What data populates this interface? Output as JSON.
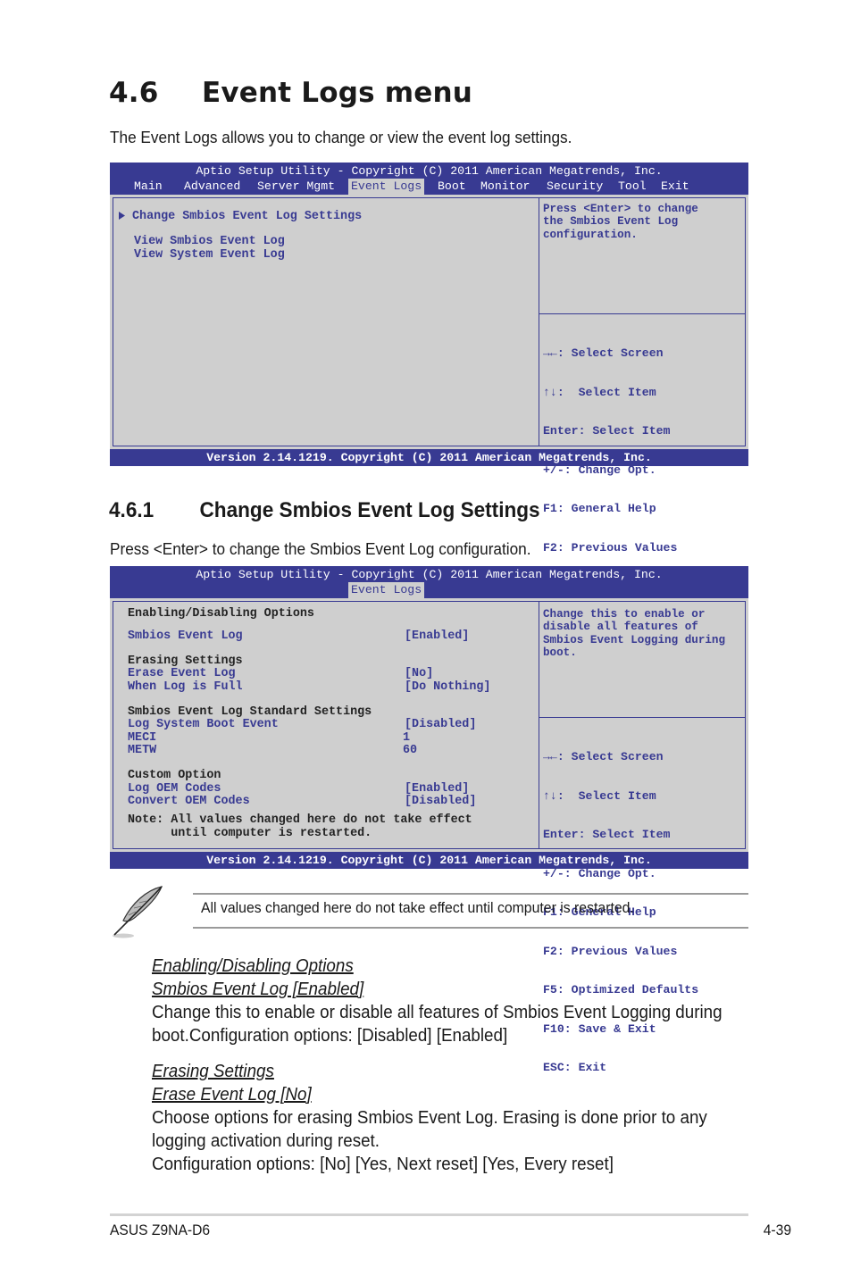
{
  "section": {
    "number": "4.6",
    "title": "Event Logs menu",
    "intro": "The Event Logs allows you to change or view the event log settings."
  },
  "bios1": {
    "title": "Aptio Setup Utility - Copyright (C) 2011 American Megatrends, Inc.",
    "tabs": [
      {
        "label": "Main",
        "active": false
      },
      {
        "label": "Advanced",
        "active": false
      },
      {
        "label": "Server Mgmt",
        "active": false
      },
      {
        "label": "Event Logs",
        "active": true
      },
      {
        "label": "Boot",
        "active": false
      },
      {
        "label": "Monitor",
        "active": false
      },
      {
        "label": "Security",
        "active": false
      },
      {
        "label": "Tool",
        "active": false
      },
      {
        "label": "Exit",
        "active": false
      }
    ],
    "items": [
      {
        "label": "Change Smbios Event Log Settings",
        "submenu": true
      },
      {
        "label": "View Smbios Event Log",
        "submenu": false
      },
      {
        "label": "View System Event Log",
        "submenu": false
      }
    ],
    "help": "Press <Enter> to change\nthe Smbios Event Log\nconfiguration.",
    "keys": [
      "→←: Select Screen",
      "↑↓:  Select Item",
      "Enter: Select Item",
      "+/-: Change Opt.",
      "F1: General Help",
      "F2: Previous Values",
      "F5: Optimized Defaults",
      "F10: Save & Exit",
      "ESC: Exit"
    ],
    "footer": "Version 2.14.1219. Copyright (C) 2011 American Megatrends, Inc."
  },
  "subsection": {
    "number": "4.6.1",
    "title": "Change Smbios Event Log Settings",
    "intro": "Press <Enter> to change the Smbios Event Log configuration."
  },
  "bios2": {
    "title": "Aptio Setup Utility - Copyright (C) 2011 American Megatrends, Inc.",
    "tab": "Event Logs",
    "headings": {
      "enabling": "Enabling/Disabling Options",
      "erasing": "Erasing Settings",
      "standard": "Smbios Event Log Standard Settings",
      "custom": "Custom Option"
    },
    "settings": {
      "smbios_event_log": {
        "label": "Smbios Event Log",
        "value": "[Enabled]"
      },
      "erase_event_log": {
        "label": "Erase Event Log",
        "value": "[No]"
      },
      "when_log_full": {
        "label": "When Log is Full",
        "value": "[Do Nothing]"
      },
      "log_system_boot": {
        "label": "Log System Boot Event",
        "value": "[Disabled]"
      },
      "meci": {
        "label": "MECI",
        "value": "1"
      },
      "metw": {
        "label": "METW",
        "value": "60"
      },
      "log_oem_codes": {
        "label": "Log OEM Codes",
        "value": "[Enabled]"
      },
      "convert_oem_codes": {
        "label": "Convert OEM Codes",
        "value": "[Disabled]"
      }
    },
    "note_line1": "Note: All values changed here do not take effect",
    "note_line2": "      until computer is restarted.",
    "help": "Change this to enable or\ndisable all features of\nSmbios Event Logging during\nboot.",
    "keys": [
      "→←: Select Screen",
      "↑↓:  Select Item",
      "Enter: Select Item",
      "+/-: Change Opt.",
      "F1: General Help",
      "F2: Previous Values",
      "F5: Optimized Defaults",
      "F10: Save & Exit",
      "ESC: Exit"
    ],
    "footer": "Version 2.14.1219. Copyright (C) 2011 American Megatrends, Inc."
  },
  "note": {
    "icon": "feather-pen-icon",
    "text": "All values changed here do not take effect until computer is restarted."
  },
  "descriptions": [
    {
      "group": "Enabling/Disabling Options",
      "item": "Smbios Event Log [Enabled]",
      "line1": "Change this to enable or disable all features of Smbios Event Logging during",
      "line2": "boot.Configuration options: [Disabled] [Enabled]"
    },
    {
      "group": "Erasing Settings",
      "item": "Erase Event Log [No]",
      "line1": "Choose options for erasing Smbios Event Log. Erasing is done prior to any",
      "line2": "logging activation during reset.",
      "line3": "Configuration options: [No] [Yes, Next reset] [Yes, Every reset]"
    }
  ],
  "footer": {
    "product": "ASUS Z9NA-D6",
    "page": "4-39"
  },
  "colors": {
    "bios_blue": "#383a92",
    "bios_gray": "#cfcfcf",
    "text": "#1a1a1a"
  }
}
